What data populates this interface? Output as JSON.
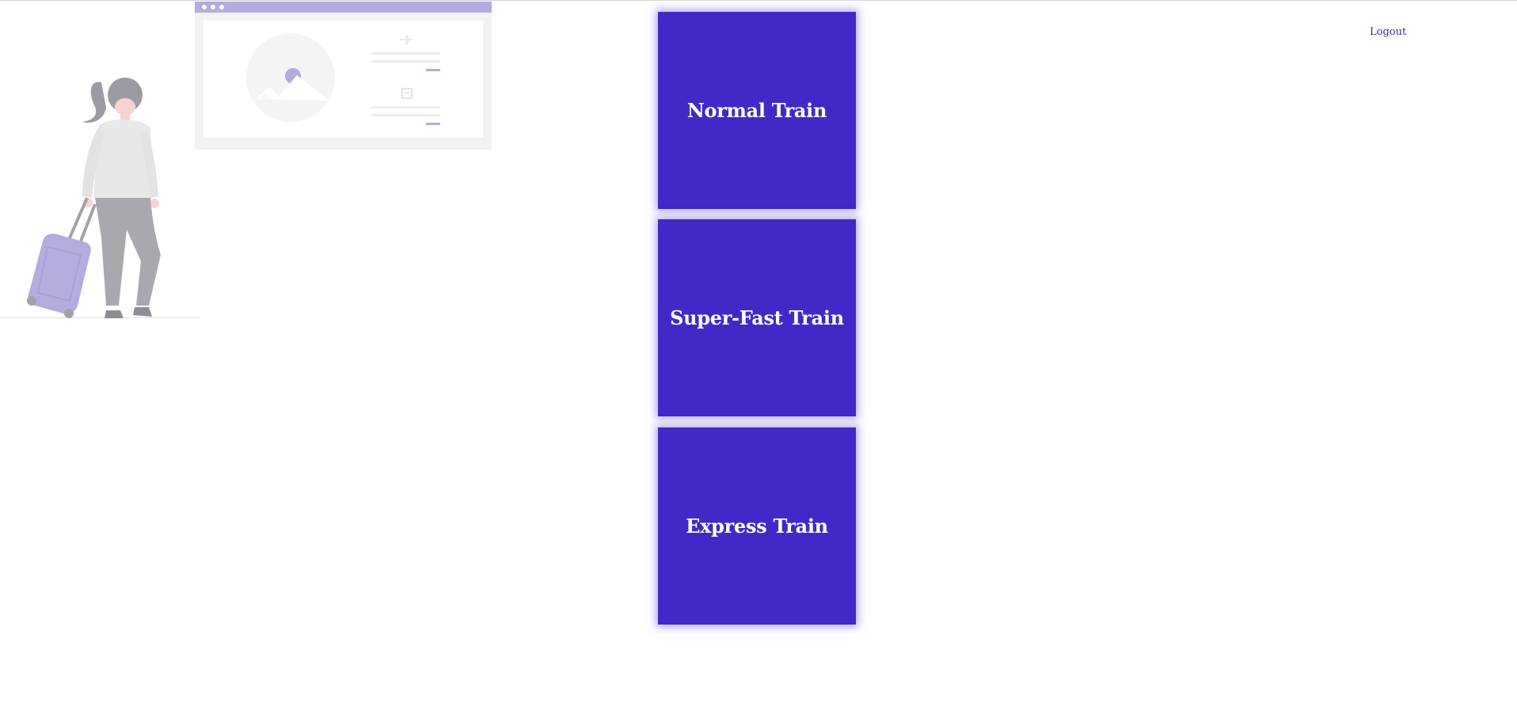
{
  "header": {
    "logout_label": "Logout"
  },
  "trains": [
    {
      "label": "Normal Train"
    },
    {
      "label": "Super-Fast Train"
    },
    {
      "label": "Express Train"
    }
  ],
  "theme": {
    "card_color": "#4129c8",
    "accent_light": "#b4acde",
    "link_color": "#3a2a9a"
  },
  "illustration": {
    "subject": "traveler-with-suitcase-and-booking-window",
    "icons": [
      "airplane-icon",
      "ticket-icon",
      "image-placeholder-icon",
      "window-dots-icon",
      "suitcase-icon"
    ]
  }
}
